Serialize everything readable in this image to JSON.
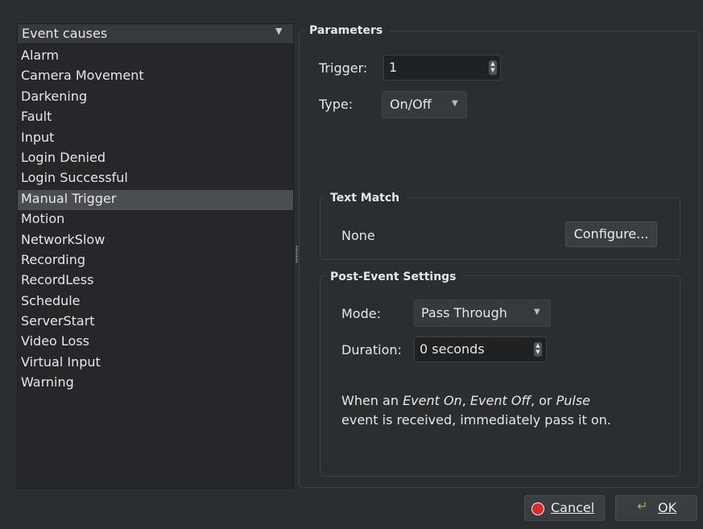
{
  "event_causes": {
    "header": "Event causes",
    "items": [
      "Alarm",
      "Camera Movement",
      "Darkening",
      "Fault",
      "Input",
      "Login Denied",
      "Login Successful",
      "Manual Trigger",
      "Motion",
      "NetworkSlow",
      "Recording",
      "RecordLess",
      "Schedule",
      "ServerStart",
      "Video Loss",
      "Virtual Input",
      "Warning"
    ],
    "selected": "Manual Trigger"
  },
  "parameters": {
    "title": "Parameters",
    "trigger_label": "Trigger:",
    "trigger_value": "1",
    "type_label": "Type:",
    "type_value": "On/Off"
  },
  "text_match": {
    "title": "Text Match",
    "value": "None",
    "configure_label": "Configure..."
  },
  "post_event": {
    "title": "Post-Event Settings",
    "mode_label": "Mode:",
    "mode_value": "Pass Through",
    "duration_label": "Duration:",
    "duration_value": "0 seconds",
    "desc_prefix": "When an ",
    "desc_event_on": "Event On",
    "desc_sep1": ", ",
    "desc_event_off": "Event Off",
    "desc_sep2": ", or ",
    "desc_pulse": "Pulse",
    "desc_line2": "event is received, immediately pass it on."
  },
  "footer": {
    "cancel_label": "Cancel",
    "ok_label": "OK"
  },
  "colors": {
    "background": "#2b2e31",
    "panel": "#25272a",
    "selected": "#4a4e53",
    "cancel_icon": "#e3262a",
    "ok_icon": "#8bc34a"
  },
  "icons": {
    "cancel": "stop-circle-icon",
    "ok": "return-arrow-icon"
  }
}
